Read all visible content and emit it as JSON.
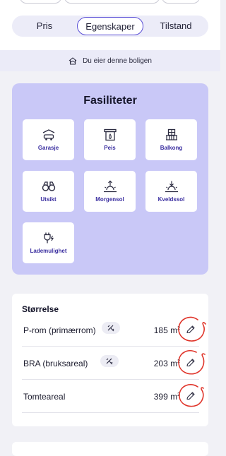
{
  "tabs": [
    {
      "label": "Pris",
      "active": false
    },
    {
      "label": "Egenskaper",
      "active": true
    },
    {
      "label": "Tilstand",
      "active": false
    }
  ],
  "banner": {
    "text": "Du eier denne boligen",
    "icon": "home-icon"
  },
  "facilities": {
    "title": "Fasiliteter",
    "items": [
      {
        "label": "Garasje",
        "icon": "garage-icon"
      },
      {
        "label": "Peis",
        "icon": "fireplace-icon"
      },
      {
        "label": "Balkong",
        "icon": "balcony-icon"
      },
      {
        "label": "Utsikt",
        "icon": "binoculars-icon"
      },
      {
        "label": "Morgensol",
        "icon": "sunrise-icon"
      },
      {
        "label": "Kveldssol",
        "icon": "sunset-icon"
      },
      {
        "label": "Lademulighet",
        "icon": "ev-charger-icon"
      }
    ]
  },
  "size": {
    "title": "Størrelse",
    "rows": [
      {
        "label": "P-rom (primærrom)",
        "value": "185 m",
        "unit_sup": "2",
        "has_badge": true
      },
      {
        "label": "BRA (bruksareal)",
        "value": "203 m",
        "unit_sup": "2",
        "has_badge": true
      },
      {
        "label": "Tomteareal",
        "value": "399 m",
        "unit_sup": "2",
        "has_badge": false
      }
    ]
  },
  "colors": {
    "accent": "#5a4fd6",
    "facilities_bg": "#c9c8f7",
    "annotation": "#e0352b"
  }
}
